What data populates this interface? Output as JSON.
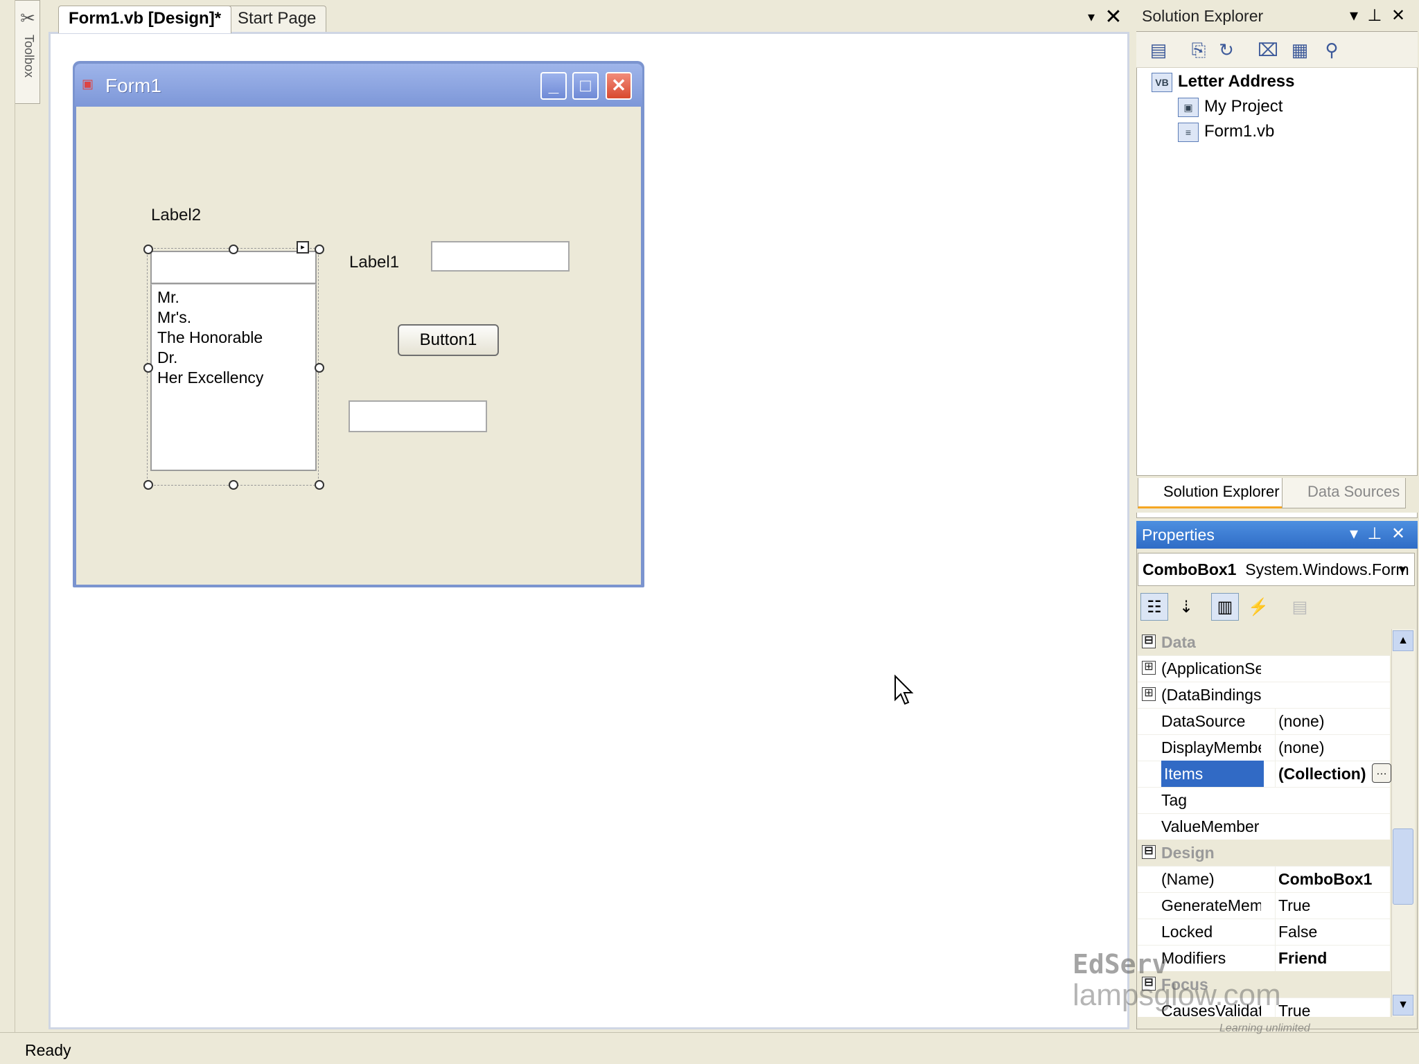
{
  "toolbox": {
    "label": "Toolbox"
  },
  "document_tabs": [
    {
      "label": "Form1.vb [Design]*",
      "active": true
    },
    {
      "label": "Start Page",
      "active": false
    }
  ],
  "tab_controls": {
    "dropdown": "▾",
    "close": "✕"
  },
  "form": {
    "title": "Form1",
    "label2": "Label2",
    "label1": "Label1",
    "button1": "Button1",
    "textbox1_value": "",
    "textbox2_value": "",
    "combo_value": "",
    "combo_items": [
      "Mr.",
      "Mr's.",
      "The Honorable",
      "Dr.",
      "Her Excellency"
    ]
  },
  "solution_explorer": {
    "title": "Solution Explorer",
    "tree": {
      "root": "Letter Address",
      "children": [
        "My Project",
        "Form1.vb"
      ]
    },
    "tabs": [
      "Solution Explorer",
      "Data Sources"
    ]
  },
  "properties": {
    "title": "Properties",
    "object_name": "ComboBox1",
    "object_type": "System.Windows.Form",
    "rows": [
      {
        "kind": "category",
        "name": "Data",
        "expander": "⊟"
      },
      {
        "kind": "prop",
        "name": "(ApplicationSetti",
        "value": "",
        "expander": "⊞"
      },
      {
        "kind": "prop",
        "name": "(DataBindings)",
        "value": "",
        "expander": "⊞"
      },
      {
        "kind": "prop",
        "name": "DataSource",
        "value": "(none)"
      },
      {
        "kind": "prop",
        "name": "DisplayMember",
        "value": "(none)"
      },
      {
        "kind": "prop",
        "name": "Items",
        "value": "(Collection)",
        "selected": true,
        "bold": true
      },
      {
        "kind": "prop",
        "name": "Tag",
        "value": ""
      },
      {
        "kind": "prop",
        "name": "ValueMember",
        "value": ""
      },
      {
        "kind": "category",
        "name": "Design",
        "expander": "⊟"
      },
      {
        "kind": "prop",
        "name": "(Name)",
        "value": "ComboBox1",
        "bold": true
      },
      {
        "kind": "prop",
        "name": "GenerateMembe",
        "value": "True"
      },
      {
        "kind": "prop",
        "name": "Locked",
        "value": "False"
      },
      {
        "kind": "prop",
        "name": "Modifiers",
        "value": "Friend",
        "bold": true
      },
      {
        "kind": "category",
        "name": "Focus",
        "expander": "⊟"
      },
      {
        "kind": "prop",
        "name": "CausesValidatio",
        "value": "True"
      }
    ]
  },
  "status_bar": {
    "text": "Ready"
  },
  "watermark": {
    "line1": "EdServ",
    "line2": "lampsglow.com",
    "tagline": "Learning unlimited"
  },
  "colors": {
    "chrome": "#ece9d8",
    "form_title_blue": "#7d97d8",
    "selection_blue": "#316ac5",
    "properties_title_blue": "#2f6cc6",
    "close_red": "#d8492f"
  }
}
